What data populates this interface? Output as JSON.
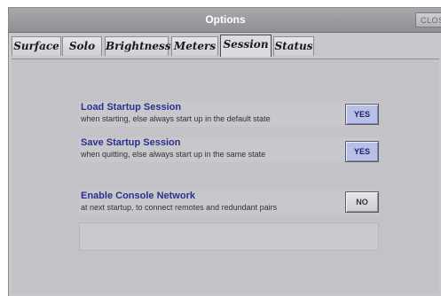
{
  "window": {
    "title": "Options",
    "close_label": "CLOS"
  },
  "tabs": [
    {
      "label": "Surface",
      "active": false
    },
    {
      "label": "Solo",
      "active": false
    },
    {
      "label": "Brightness",
      "active": false
    },
    {
      "label": "Meters",
      "active": false
    },
    {
      "label": "Session",
      "active": true
    },
    {
      "label": "Status",
      "active": false
    }
  ],
  "session": {
    "load_startup": {
      "heading": "Load Startup Session",
      "description": "when starting, else always start up in the default state",
      "button": "YES"
    },
    "save_startup": {
      "heading": "Save Startup Session",
      "description": "when quitting, else always start up in the same state",
      "button": "YES"
    },
    "console_network": {
      "heading": "Enable Console Network",
      "description": "at next startup, to connect remotes and redundant pairs",
      "button": "NO"
    }
  },
  "colors": {
    "heading": "#2b2f8e",
    "yes_button": "#b8c0e8",
    "panel_bg": "#c2c2c7"
  }
}
